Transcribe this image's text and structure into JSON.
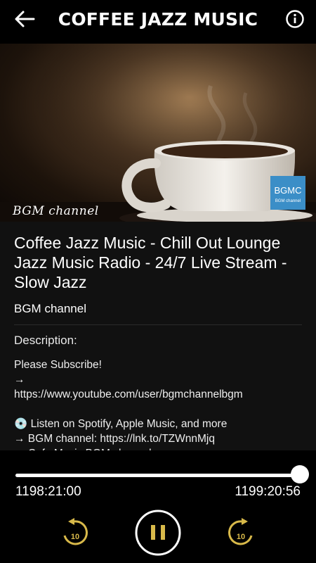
{
  "appbar": {
    "title": "COFFEE JAZZ MUSIC",
    "back_icon": "arrow-left-icon",
    "info_icon": "info-circle-icon"
  },
  "thumbnail": {
    "watermark": "BGM channel",
    "logo_text": "BGMC",
    "logo_sub": "BGM channel",
    "logo_color": "#3b8ec7"
  },
  "video": {
    "title": "Coffee Jazz Music - Chill Out Lounge Jazz Music Radio - 24/7 Live Stream - Slow Jazz",
    "channel": "BGM channel",
    "description_heading": "Description:",
    "description": "Please Subscribe!\n→\nhttps://www.youtube.com/user/bgmchannelbgm\n\n💿 Listen on Spotify, Apple Music, and more\n→ BGM channel: https://lnk.to/TZWnnMjq\n→ Cafe Music BGM channel:"
  },
  "player": {
    "elapsed": "1198:21:00",
    "total": "1199:20:56",
    "progress": 0.9992,
    "rewind_seconds": "10",
    "forward_seconds": "10",
    "accent": "#d8b94a"
  }
}
